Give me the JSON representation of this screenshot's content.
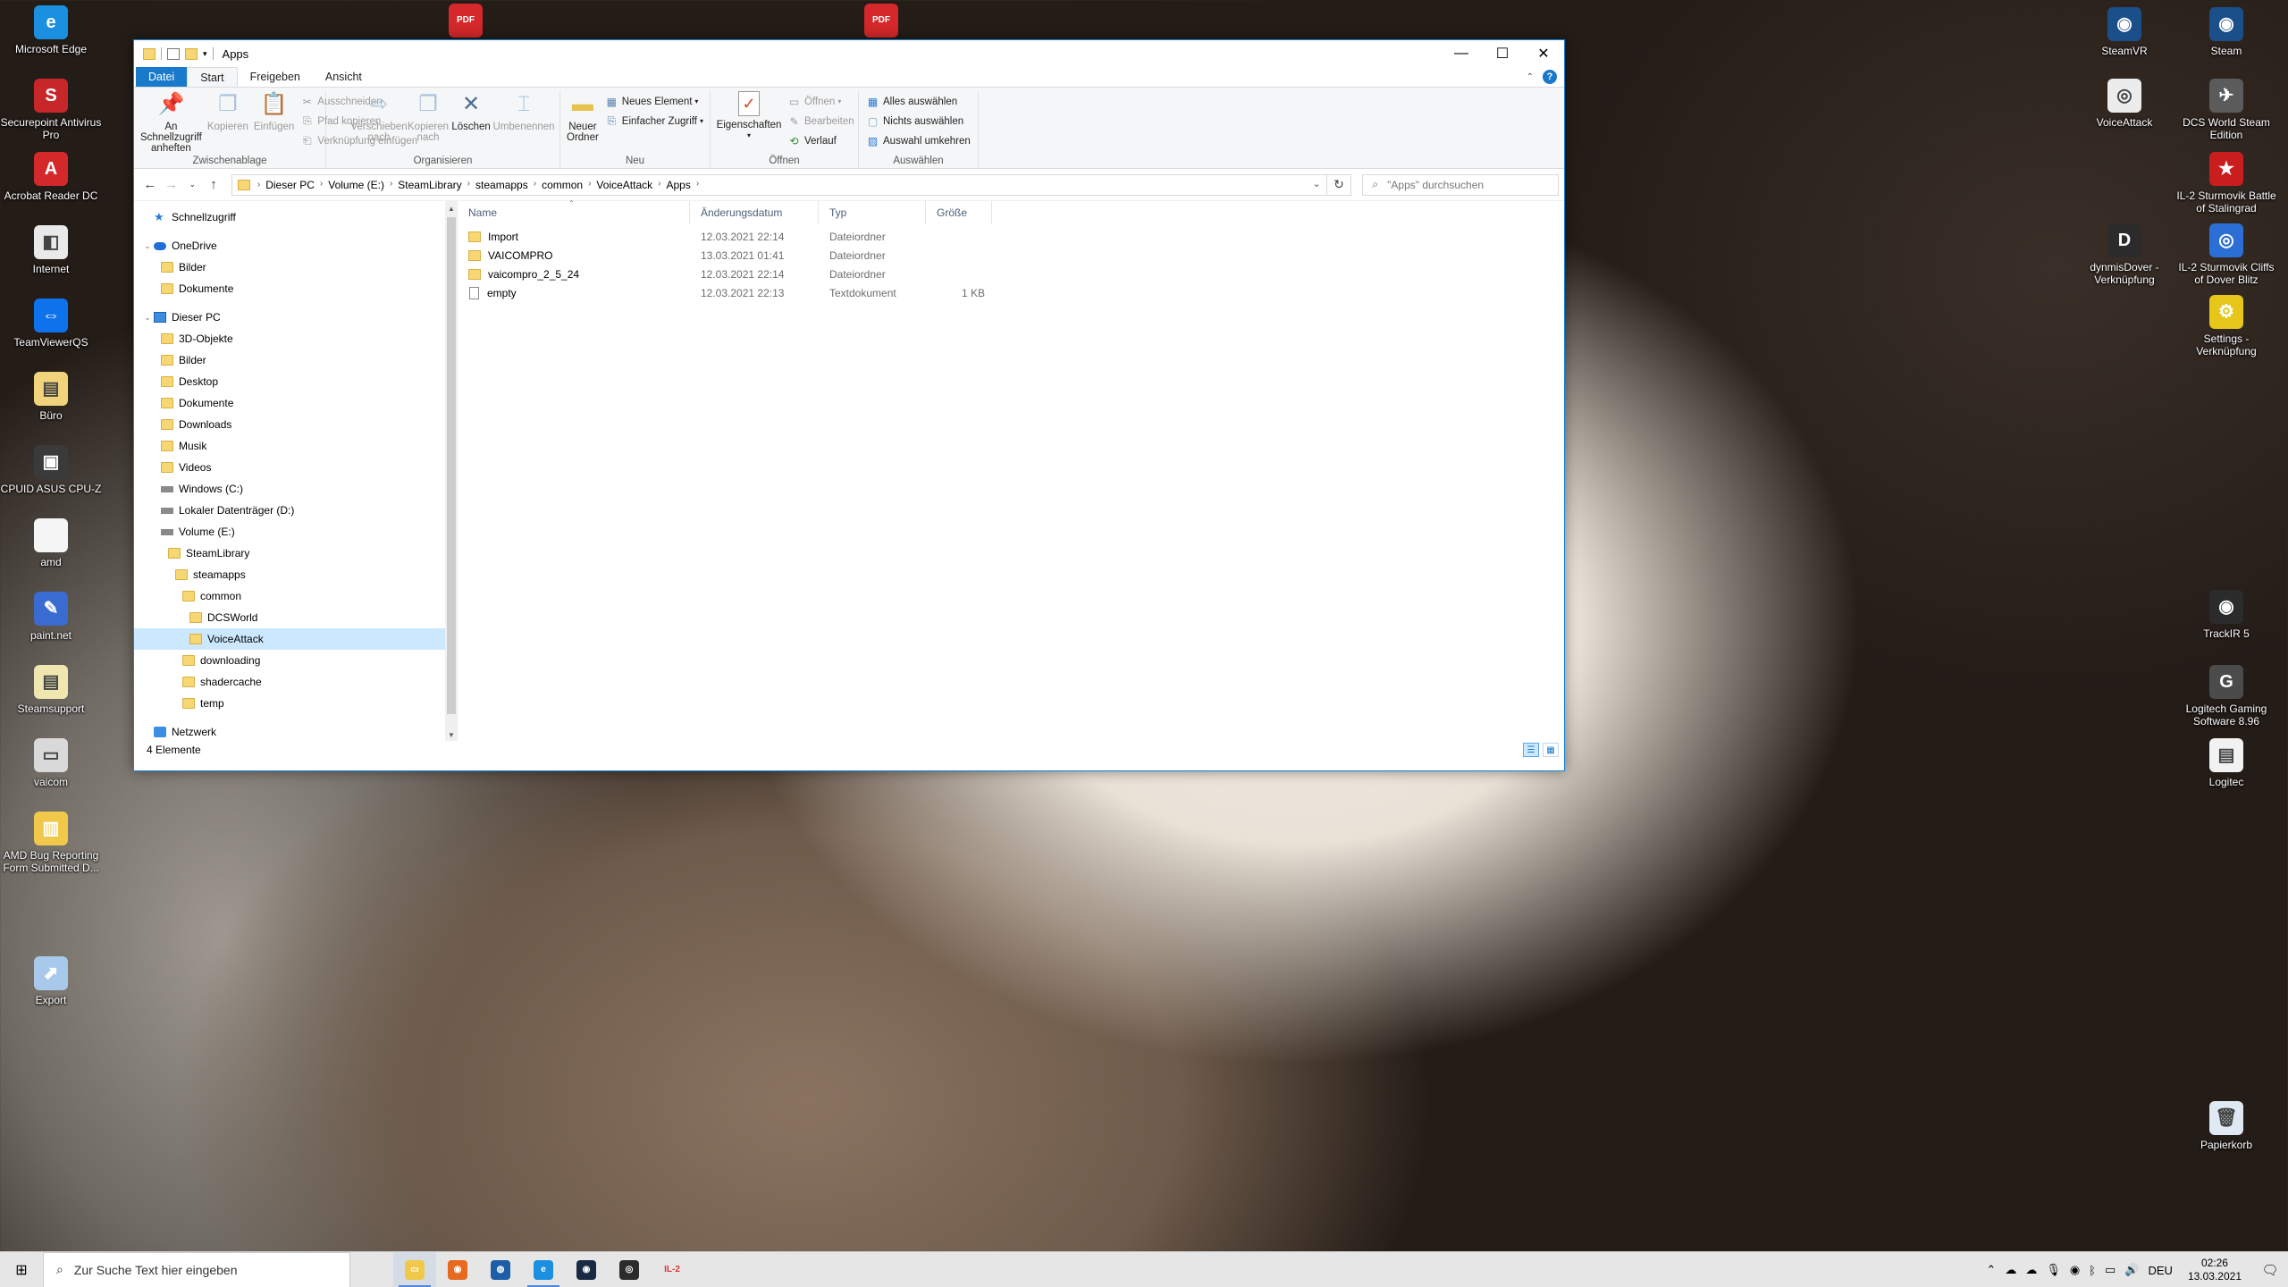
{
  "desktop_left": [
    {
      "label": "Microsoft Edge",
      "icon": "edge-icon",
      "color": "#1b8fe0",
      "glyph": "e"
    },
    {
      "label": "Securepoint Antivirus Pro",
      "icon": "antivirus-icon",
      "color": "#c8272a",
      "glyph": "S"
    },
    {
      "label": "Acrobat Reader DC",
      "icon": "acrobat-icon",
      "color": "#d4282a",
      "glyph": "A"
    },
    {
      "label": "Internet",
      "icon": "internet-shortcut-icon",
      "color": "#e9e9e9",
      "glyph": "◧"
    },
    {
      "label": "TeamViewerQS",
      "icon": "teamviewer-icon",
      "color": "#0e72ed",
      "glyph": "⇔"
    },
    {
      "label": "Büro",
      "icon": "folder-shortcut-icon",
      "color": "#f0d37a",
      "glyph": "▤"
    },
    {
      "label": "CPUID ASUS CPU-Z",
      "icon": "cpuz-icon",
      "color": "#3a3a3a",
      "glyph": "▣"
    },
    {
      "label": "amd",
      "icon": "file-icon",
      "color": "#f5f5f5",
      "glyph": ""
    },
    {
      "label": "paint.net",
      "icon": "paintnet-icon",
      "color": "#3a6bd1",
      "glyph": "✎"
    },
    {
      "label": "Steamsupport",
      "icon": "document-icon",
      "color": "#efe6b0",
      "glyph": "▤"
    },
    {
      "label": "vaicom",
      "icon": "drive-icon",
      "color": "#d9d9d9",
      "glyph": "▭"
    },
    {
      "label": "AMD Bug Reporting Form Submitted D...",
      "icon": "zip-folder-icon",
      "color": "#f0c94a",
      "glyph": "▥"
    },
    {
      "label": "Export",
      "icon": "export-icon",
      "color": "#a9c9ea",
      "glyph": "⬈"
    }
  ],
  "desktop_top": [
    {
      "label": "",
      "icon": "pdf-file-icon",
      "color": "#d4282a",
      "glyph": "PDF"
    },
    {
      "label": "",
      "icon": "pdf-file-icon",
      "color": "#d4282a",
      "glyph": "PDF"
    }
  ],
  "desktop_right": [
    {
      "label": "SteamVR",
      "icon": "steamvr-icon",
      "color": "#1b4f8a",
      "glyph": "◉"
    },
    {
      "label": "Steam",
      "icon": "steam-icon",
      "color": "#1b4f8a",
      "glyph": "◉"
    },
    {
      "label": "VoiceAttack",
      "icon": "voiceattack-icon",
      "color": "#ececec",
      "glyph": "◎"
    },
    {
      "label": "DCS World Steam Edition",
      "icon": "dcs-icon",
      "color": "#5b5b5b",
      "glyph": "✈"
    },
    {
      "label": "IL-2 Sturmovik Battle of Stalingrad",
      "icon": "il2-star-icon",
      "color": "#c81e1e",
      "glyph": "★"
    },
    {
      "label": "dynmisDover - Verknüpfung",
      "icon": "dynmis-icon",
      "color": "#2b2b2b",
      "glyph": "D"
    },
    {
      "label": "IL-2 Sturmovik Cliffs of Dover Blitz",
      "icon": "il2-cod-icon",
      "color": "#2b6fd6",
      "glyph": "◎"
    },
    {
      "label": "Settings - Verknüpfung",
      "icon": "settings-icon",
      "color": "#e6c619",
      "glyph": "⚙"
    },
    {
      "label": "TrackIR 5",
      "icon": "trackir-icon",
      "color": "#2b2b2b",
      "glyph": "◉"
    },
    {
      "label": "Logitech Gaming Software 8.96",
      "icon": "logitech-icon",
      "color": "#4b4b4b",
      "glyph": "G"
    },
    {
      "label": "Logitec",
      "icon": "document-icon",
      "color": "#f2f2f2",
      "glyph": "▤"
    },
    {
      "label": "Papierkorb",
      "icon": "recycle-bin-icon",
      "color": "#dfe9f3",
      "glyph": "🗑"
    }
  ],
  "window": {
    "title": "Apps",
    "ribbon_tabs": [
      "Datei",
      "Start",
      "Freigeben",
      "Ansicht"
    ],
    "groups": {
      "clipboard": {
        "title": "Zwischenablage",
        "pin": "An Schnellzugriff anheften",
        "copy": "Kopieren",
        "paste": "Einfügen",
        "cut": "Ausschneiden",
        "copy_path": "Pfad kopieren",
        "paste_shortcut": "Verknüpfung einfügen"
      },
      "organize": {
        "title": "Organisieren",
        "move": "Verschieben nach",
        "copy_to": "Kopieren nach",
        "delete": "Löschen",
        "rename": "Umbenennen"
      },
      "new": {
        "title": "Neu",
        "new_folder": "Neuer Ordner",
        "new_item": "Neues Element",
        "easy_access": "Einfacher Zugriff"
      },
      "open": {
        "title": "Öffnen",
        "properties": "Eigenschaften",
        "open": "Öffnen",
        "edit": "Bearbeiten",
        "history": "Verlauf"
      },
      "select": {
        "title": "Auswählen",
        "select_all": "Alles auswählen",
        "select_none": "Nichts auswählen",
        "invert": "Auswahl umkehren"
      }
    },
    "breadcrumb": [
      "Dieser PC",
      "Volume (E:)",
      "SteamLibrary",
      "steamapps",
      "common",
      "VoiceAttack",
      "Apps"
    ],
    "search_placeholder": "\"Apps\" durchsuchen",
    "nav": [
      {
        "label": "Schnellzugriff",
        "type": "star",
        "indent": 0,
        "gap": false
      },
      {
        "label": "OneDrive",
        "type": "cloud",
        "indent": 0,
        "gap": true,
        "exp": "⌄"
      },
      {
        "label": "Bilder",
        "type": "folder",
        "indent": 1
      },
      {
        "label": "Dokumente",
        "type": "folder",
        "indent": 1
      },
      {
        "label": "Dieser PC",
        "type": "pc",
        "indent": 0,
        "gap": true,
        "exp": "⌄"
      },
      {
        "label": "3D-Objekte",
        "type": "folder",
        "indent": 1
      },
      {
        "label": "Bilder",
        "type": "folder",
        "indent": 1
      },
      {
        "label": "Desktop",
        "type": "folder",
        "indent": 1
      },
      {
        "label": "Dokumente",
        "type": "folder",
        "indent": 1
      },
      {
        "label": "Downloads",
        "type": "folder",
        "indent": 1
      },
      {
        "label": "Musik",
        "type": "folder",
        "indent": 1
      },
      {
        "label": "Videos",
        "type": "folder",
        "indent": 1
      },
      {
        "label": "Windows (C:)",
        "type": "drive",
        "indent": 1
      },
      {
        "label": "Lokaler Datenträger (D:)",
        "type": "drive",
        "indent": 1
      },
      {
        "label": "Volume (E:)",
        "type": "drive",
        "indent": 1
      },
      {
        "label": "SteamLibrary",
        "type": "folder",
        "indent": 2
      },
      {
        "label": "steamapps",
        "type": "folder",
        "indent": 3
      },
      {
        "label": "common",
        "type": "folder",
        "indent": 4
      },
      {
        "label": "DCSWorld",
        "type": "folder",
        "indent": 5
      },
      {
        "label": "VoiceAttack",
        "type": "folder",
        "indent": 5,
        "selected": true
      },
      {
        "label": "downloading",
        "type": "folder",
        "indent": 4
      },
      {
        "label": "shadercache",
        "type": "folder",
        "indent": 4
      },
      {
        "label": "temp",
        "type": "folder",
        "indent": 4
      },
      {
        "label": "Netzwerk",
        "type": "net",
        "indent": 0,
        "gap": true
      }
    ],
    "columns": [
      "Name",
      "Änderungsdatum",
      "Typ",
      "Größe"
    ],
    "files": [
      {
        "name": "Import",
        "date": "12.03.2021 22:14",
        "type": "Dateiordner",
        "size": "",
        "kind": "folder"
      },
      {
        "name": "VAICOMPRO",
        "date": "13.03.2021 01:41",
        "type": "Dateiordner",
        "size": "",
        "kind": "folder"
      },
      {
        "name": "vaicompro_2_5_24",
        "date": "12.03.2021 22:14",
        "type": "Dateiordner",
        "size": "",
        "kind": "folder"
      },
      {
        "name": "empty",
        "date": "12.03.2021 22:13",
        "type": "Textdokument",
        "size": "1 KB",
        "kind": "txt"
      }
    ],
    "status": "4 Elemente"
  },
  "taskbar": {
    "search_placeholder": "Zur Suche Text hier eingeben",
    "apps": [
      {
        "name": "file-explorer",
        "color": "#f0c94a",
        "glyph": "▭",
        "active": true
      },
      {
        "name": "firefox",
        "color": "#e66a1f",
        "glyph": "◉"
      },
      {
        "name": "app-blue",
        "color": "#1e5ea8",
        "glyph": "◍"
      },
      {
        "name": "edge",
        "color": "#1b8fe0",
        "glyph": "e",
        "run": true
      },
      {
        "name": "steam",
        "color": "#1b2a44",
        "glyph": "◉"
      },
      {
        "name": "trackir",
        "color": "#2b2b2b",
        "glyph": "◎"
      },
      {
        "name": "il2",
        "color": "#9b1b1b",
        "glyph": "IL-2"
      }
    ],
    "lang": "DEU",
    "time": "02:26",
    "date": "13.03.2021"
  }
}
